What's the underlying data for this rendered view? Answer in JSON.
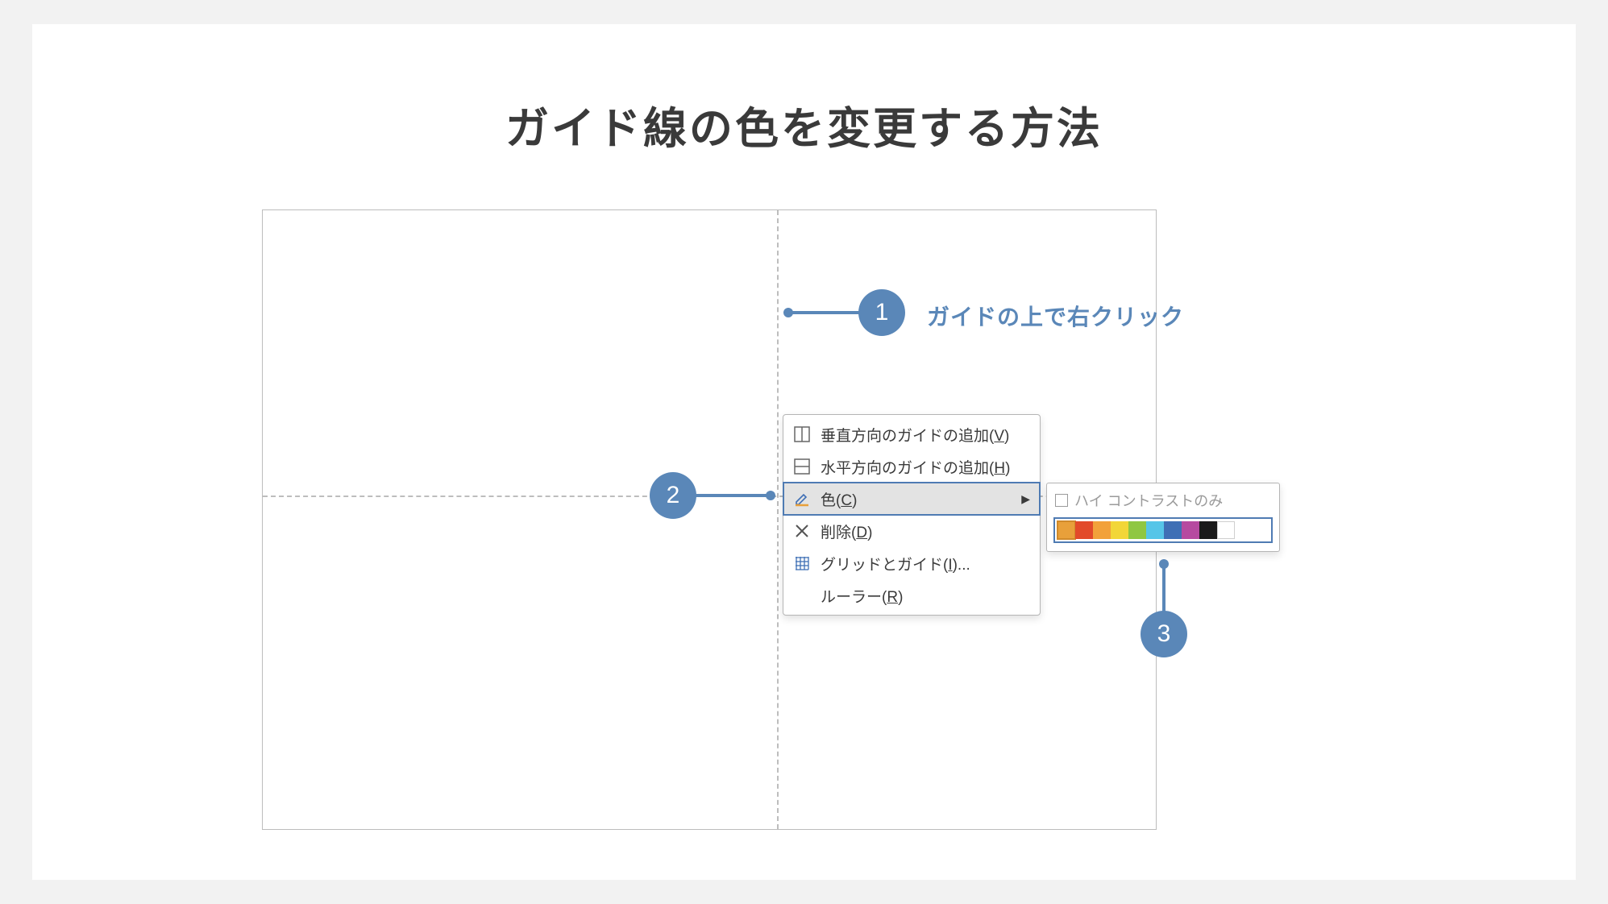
{
  "title": "ガイド線の色を変更する方法",
  "steps": {
    "one": {
      "num": "1",
      "label": "ガイドの上で右クリック"
    },
    "two": {
      "num": "2"
    },
    "three": {
      "num": "3"
    }
  },
  "menu": {
    "add_v": {
      "text": "垂直方向のガイドの追加(",
      "u": "V",
      "tail": ")"
    },
    "add_h": {
      "text": "水平方向のガイドの追加(",
      "u": "H",
      "tail": ")"
    },
    "color": {
      "text": "色(",
      "u": "C",
      "tail": ")"
    },
    "del": {
      "text": "削除(",
      "u": "D",
      "tail": ")"
    },
    "grid": {
      "text": "グリッドとガイド(",
      "u": "I",
      "tail": ")..."
    },
    "ruler": {
      "text": "ルーラー(",
      "u": "R",
      "tail": ")"
    }
  },
  "flyout": {
    "hc_label": "ハイ コントラストのみ",
    "colors": [
      "#e8a03a",
      "#e24a2a",
      "#f2a13a",
      "#f2d638",
      "#8fc742",
      "#56c5e8",
      "#3f6fb5",
      "#b64aa0",
      "#1a1a1a",
      "#ffffff"
    ]
  }
}
